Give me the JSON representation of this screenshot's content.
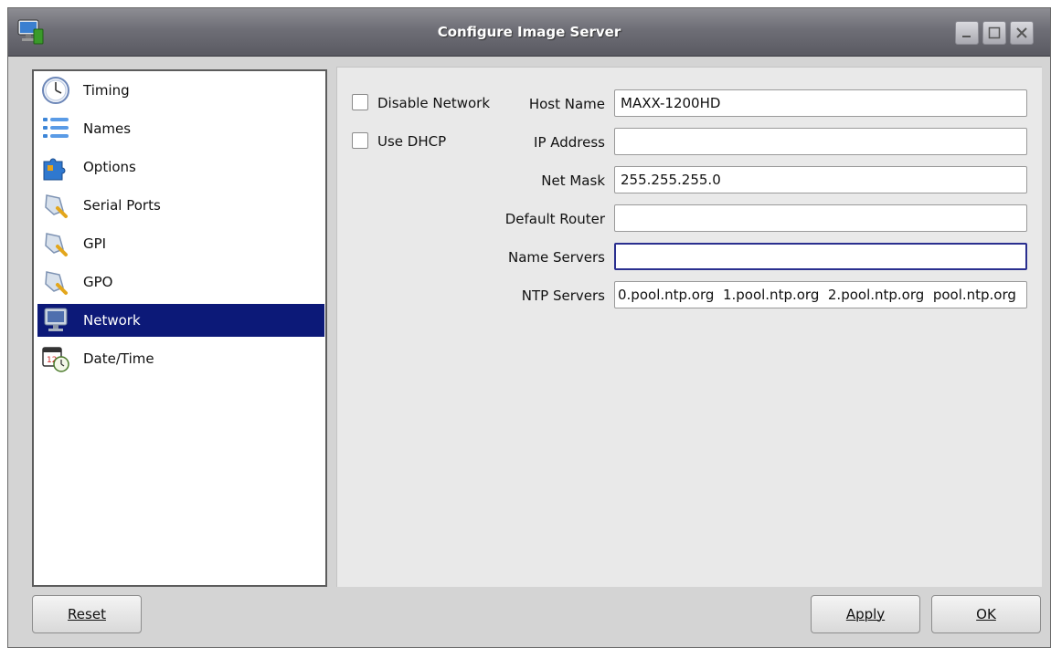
{
  "window": {
    "title": "Configure Image Server"
  },
  "sidebar": {
    "items": [
      {
        "label": "Timing",
        "icon": "clock-icon"
      },
      {
        "label": "Names",
        "icon": "list-icon"
      },
      {
        "label": "Options",
        "icon": "puzzle-icon"
      },
      {
        "label": "Serial Ports",
        "icon": "connector-icon"
      },
      {
        "label": "GPI",
        "icon": "connector-icon"
      },
      {
        "label": "GPO",
        "icon": "connector-icon"
      },
      {
        "label": "Network",
        "icon": "monitor-icon",
        "selected": true
      },
      {
        "label": "Date/Time",
        "icon": "calendar-clock-icon"
      }
    ]
  },
  "network": {
    "disable_network_label": "Disable Network",
    "disable_network_checked": false,
    "use_dhcp_label": "Use DHCP",
    "use_dhcp_checked": false,
    "host_name_label": "Host Name",
    "host_name_value": "MAXX-1200HD",
    "ip_address_label": "IP Address",
    "ip_address_value": "",
    "net_mask_label": "Net Mask",
    "net_mask_value": "255.255.255.0",
    "default_router_label": "Default Router",
    "default_router_value": "",
    "name_servers_label": "Name Servers",
    "name_servers_value": "",
    "ntp_servers_label": "NTP Servers",
    "ntp_servers_value": "0.pool.ntp.org  1.pool.ntp.org  2.pool.ntp.org  pool.ntp.org"
  },
  "buttons": {
    "reset": "Reset",
    "apply": "Apply",
    "ok": "OK"
  },
  "colors": {
    "selection": "#0c1978",
    "focus_border": "#2a2f8f"
  }
}
